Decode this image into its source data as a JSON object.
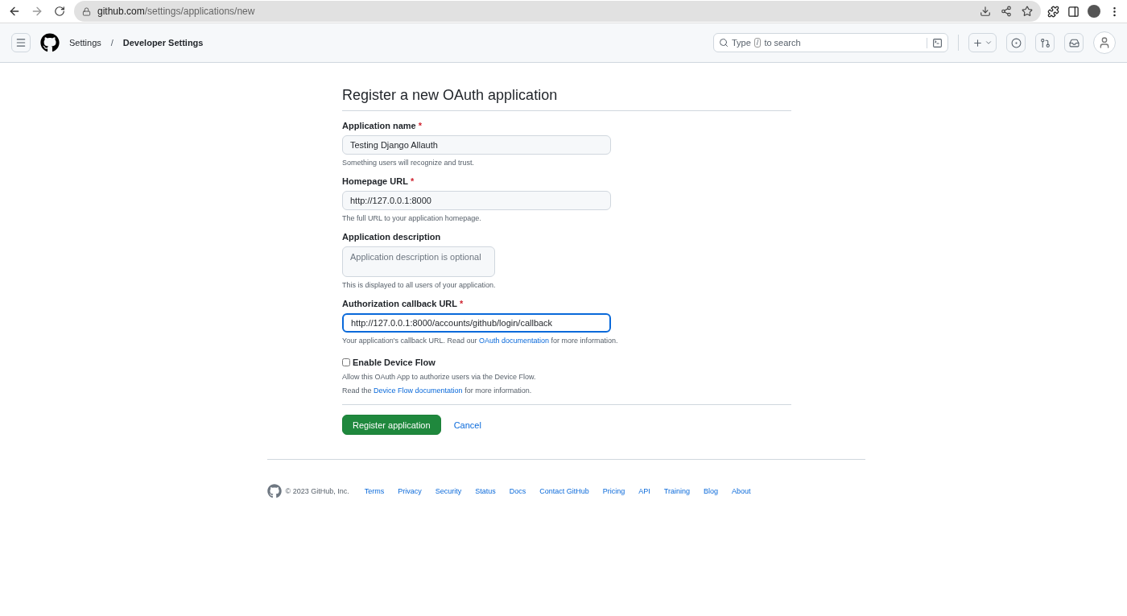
{
  "browser": {
    "url_host": "github.com",
    "url_path": "/settings/applications/new"
  },
  "header": {
    "breadcrumbs": [
      {
        "label": "Settings",
        "current": false
      },
      {
        "label": "Developer Settings",
        "current": true
      }
    ],
    "separator": "/",
    "search": {
      "before": "Type",
      "key": "/",
      "after": "to search"
    }
  },
  "form": {
    "title": "Register a new OAuth application",
    "required_mark": "*",
    "fields": [
      {
        "kind": "input",
        "label": "Application name",
        "required": true,
        "value": "Testing Django Allauth",
        "focused": false,
        "hint": "Something users will recognize and trust."
      },
      {
        "kind": "input",
        "label": "Homepage URL",
        "required": true,
        "value": "http://127.0.0.1:8000",
        "focused": false,
        "hint": "The full URL to your application homepage."
      },
      {
        "kind": "textarea",
        "label": "Application description",
        "required": false,
        "placeholder": "Application description is optional",
        "hint": "This is displayed to all users of your application."
      },
      {
        "kind": "input",
        "label": "Authorization callback URL",
        "required": true,
        "value": "http://127.0.0.1:8000/accounts/github/login/callback",
        "focused": true,
        "hint": "Your application's callback URL. Read our",
        "hint_link": "OAuth documentation",
        "hint_after": "for more information."
      }
    ],
    "checkbox": {
      "label": "Enable Device Flow",
      "checked": false,
      "notes": [
        {
          "before": "Allow this OAuth App to authorize users via the Device Flow."
        },
        {
          "before": "Read the",
          "link": "Device Flow documentation",
          "after": "for more information."
        }
      ]
    },
    "submit": "Register application",
    "cancel": "Cancel"
  },
  "footer": {
    "copyright": "© 2023 GitHub, Inc.",
    "links": [
      "Terms",
      "Privacy",
      "Security",
      "Status",
      "Docs",
      "Contact GitHub",
      "Pricing",
      "API",
      "Training",
      "Blog",
      "About"
    ]
  }
}
